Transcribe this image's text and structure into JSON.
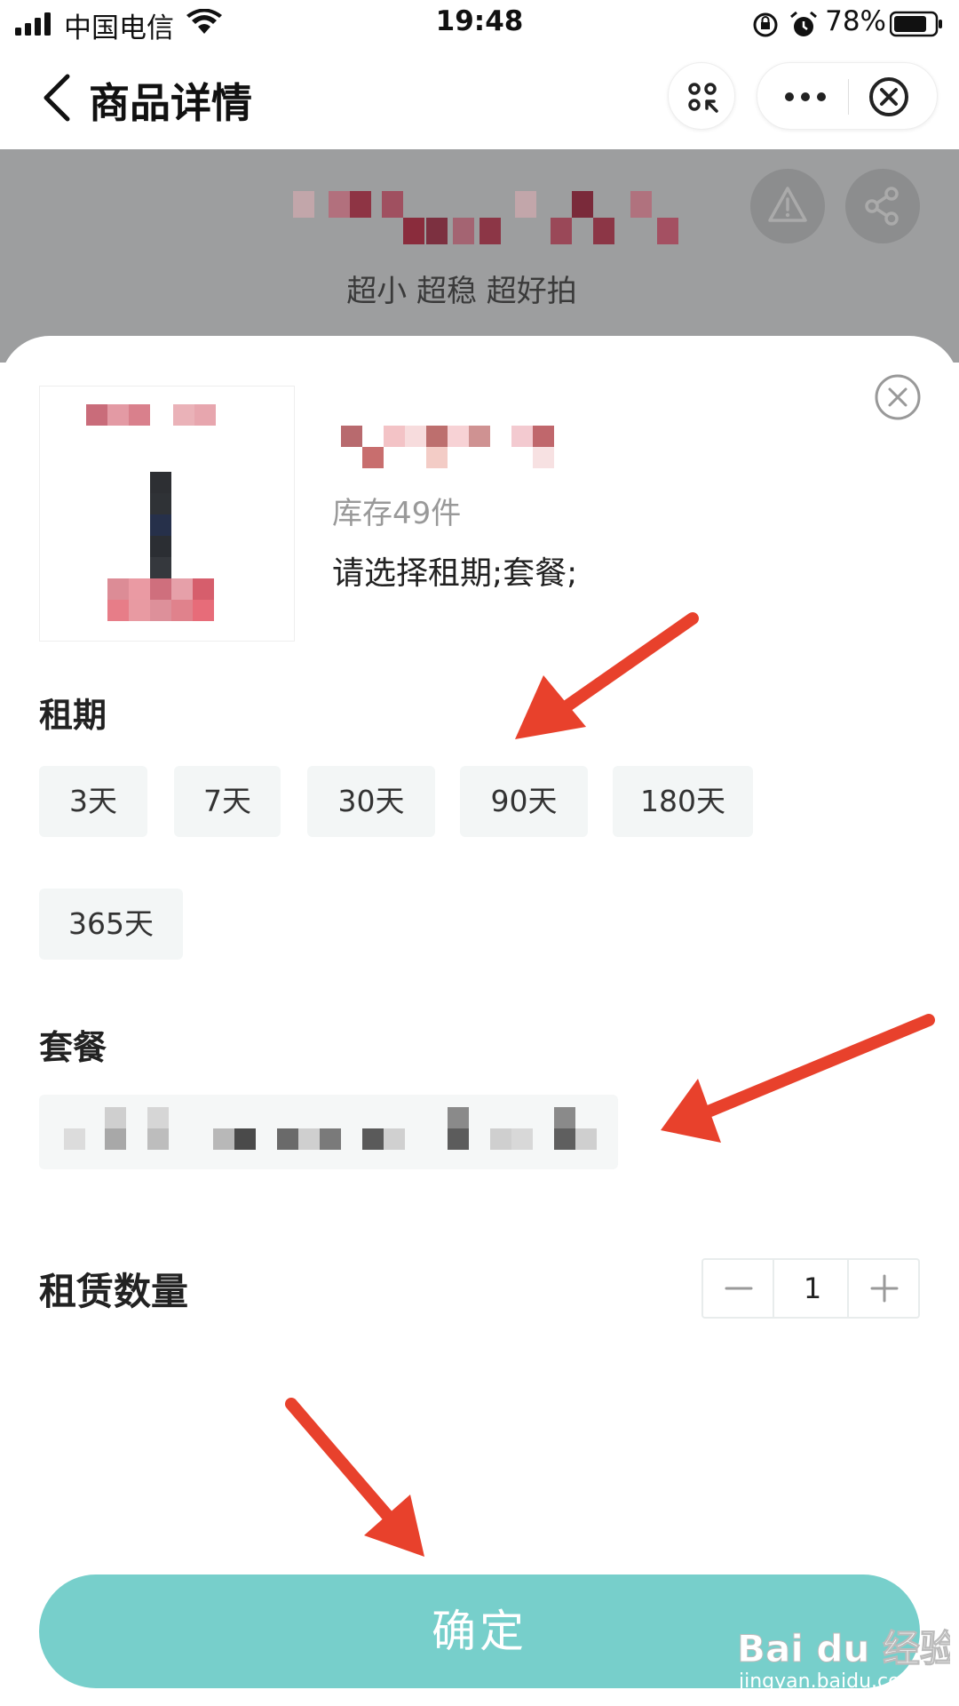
{
  "status_bar": {
    "carrier": "中国电信",
    "time": "19:48",
    "battery_percent": "78%",
    "icons": [
      "signal-icon",
      "wifi-icon",
      "rotation-lock-icon",
      "alarm-icon",
      "battery-icon"
    ]
  },
  "navbar": {
    "title": "商品详情"
  },
  "banner": {
    "subtitle": "超小 超稳 超好拍"
  },
  "sheet": {
    "stock": "库存49件",
    "prompt": "请选择租期;套餐;",
    "rental_period": {
      "label": "租期",
      "options": [
        "3天",
        "7天",
        "30天",
        "90天",
        "180天",
        "365天"
      ]
    },
    "package": {
      "label": "套餐"
    },
    "quantity": {
      "label": "租赁数量",
      "value": "1",
      "minus": "−",
      "plus": "+"
    },
    "confirm_label": "确定"
  },
  "watermark": {
    "brand": "Bai du 经验",
    "url": "jingyan.baidu.com"
  },
  "colors": {
    "accent": "#77cfcb",
    "arrow": "#e8412c",
    "dim_overlay": "#9d9e9f"
  }
}
